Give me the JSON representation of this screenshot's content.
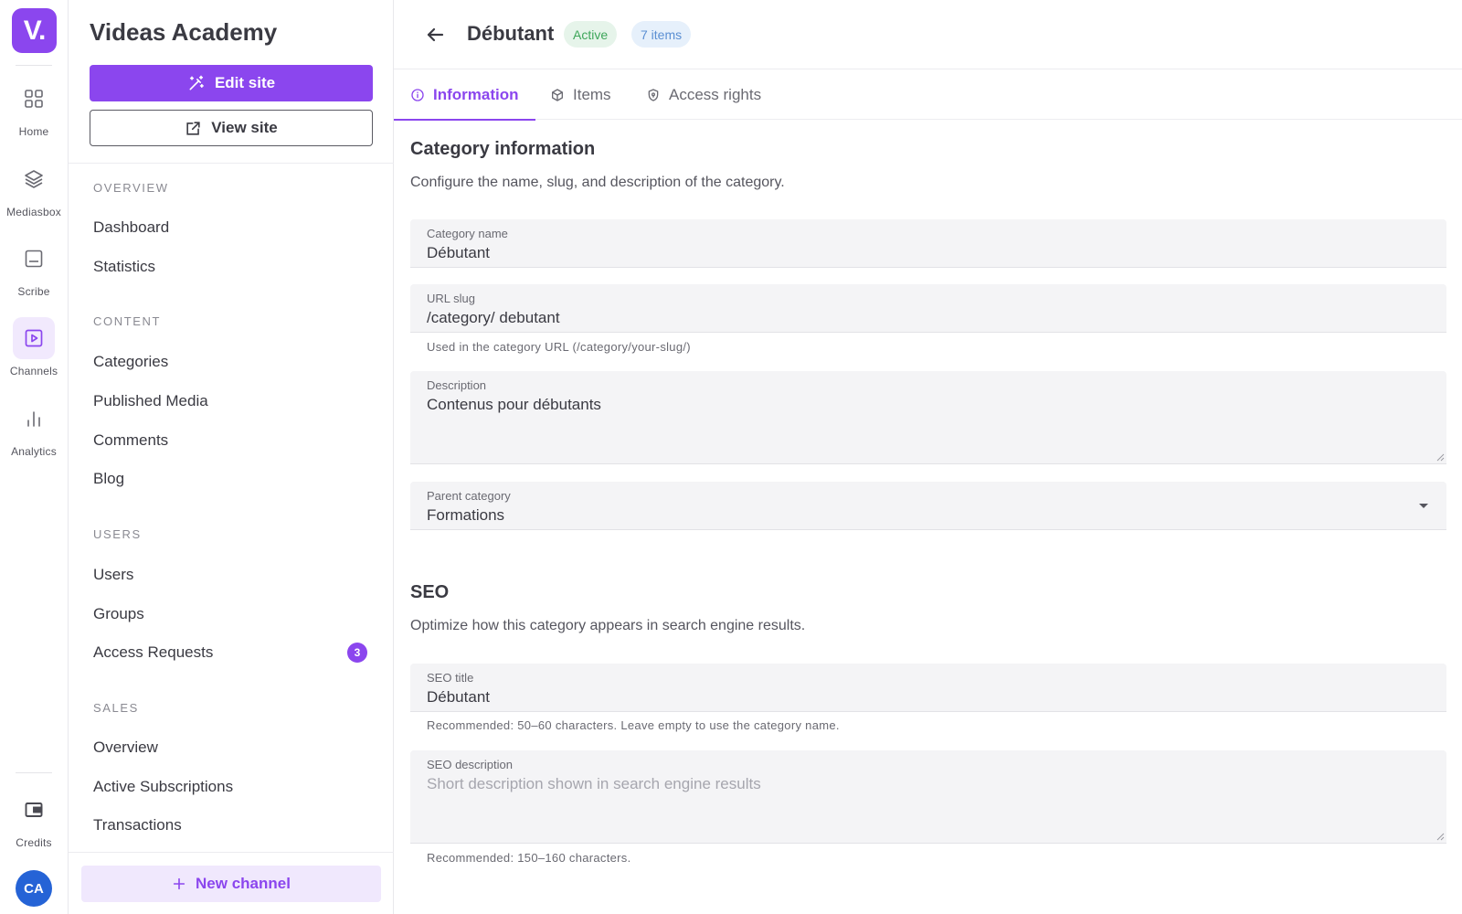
{
  "rail": {
    "logo": "V.",
    "items": [
      {
        "label": "Home",
        "icon": "grid-icon"
      },
      {
        "label": "Mediasbox",
        "icon": "layers-icon"
      },
      {
        "label": "Scribe",
        "icon": "subtitles-icon"
      },
      {
        "label": "Channels",
        "icon": "play-square-icon",
        "active": true
      },
      {
        "label": "Analytics",
        "icon": "bar-chart-icon"
      }
    ],
    "credits_label": "Credits",
    "avatar_initials": "CA"
  },
  "sidebar": {
    "site_title": "Videas Academy",
    "edit_site": "Edit site",
    "view_site": "View site",
    "sections": {
      "overview": "OVERVIEW",
      "content": "CONTENT",
      "users": "USERS",
      "sales": "SALES"
    },
    "items": {
      "dashboard": "Dashboard",
      "statistics": "Statistics",
      "categories": "Categories",
      "published_media": "Published Media",
      "comments": "Comments",
      "blog": "Blog",
      "users": "Users",
      "groups": "Groups",
      "access_requests": "Access Requests",
      "access_requests_count": "3",
      "sales_overview": "Overview",
      "active_subscriptions": "Active Subscriptions",
      "transactions": "Transactions"
    },
    "new_channel": "New channel"
  },
  "header": {
    "title": "Débutant",
    "status": "Active",
    "items_count": "7 items"
  },
  "tabs": {
    "information": "Information",
    "items": "Items",
    "access_rights": "Access rights"
  },
  "category_info": {
    "heading": "Category information",
    "description": "Configure the name, slug, and description of the category.",
    "name_label": "Category name",
    "name_value": "Débutant",
    "slug_label": "URL slug",
    "slug_value": "/category/ debutant",
    "slug_helper": "Used in the category URL (/category/your-slug/)",
    "description_label": "Description",
    "description_value": "Contenus pour débutants",
    "parent_label": "Parent category",
    "parent_value": "Formations"
  },
  "seo": {
    "heading": "SEO",
    "description": "Optimize how this category appears in search engine results.",
    "title_label": "SEO title",
    "title_value": "Débutant",
    "title_helper": "Recommended: 50–60 characters. Leave empty to use the category name.",
    "desc_label": "SEO description",
    "desc_placeholder": "Short description shown in search engine results",
    "desc_helper": "Recommended: 150–160 characters."
  },
  "colors": {
    "accent": "#8b46ee",
    "accent_soft": "#f0e8fd",
    "success": "#3ea65a",
    "info": "#5b8fd3",
    "avatar": "#2563d6"
  }
}
